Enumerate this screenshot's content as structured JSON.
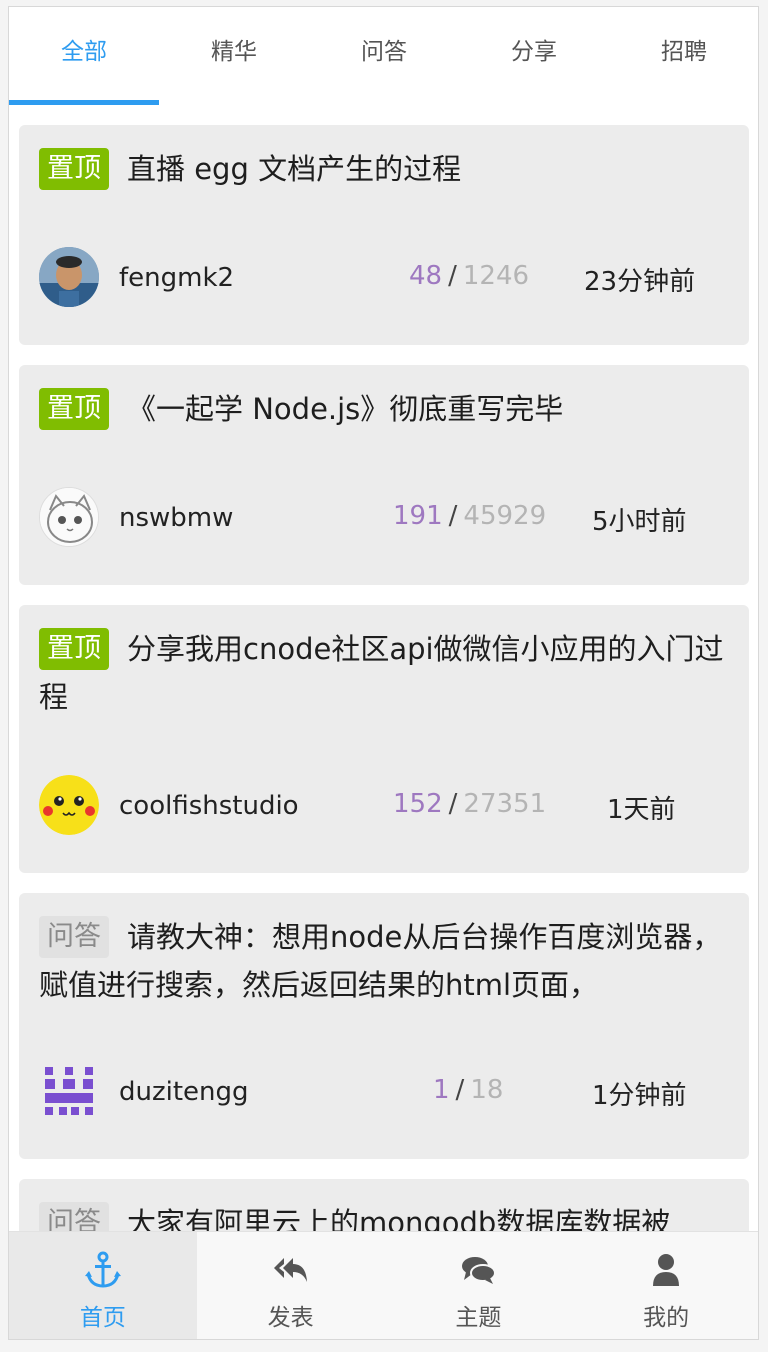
{
  "tabs": [
    {
      "label": "全部",
      "active": true
    },
    {
      "label": "精华",
      "active": false
    },
    {
      "label": "问答",
      "active": false
    },
    {
      "label": "分享",
      "active": false
    },
    {
      "label": "招聘",
      "active": false
    }
  ],
  "topics": [
    {
      "tag": "置顶",
      "title": "直播 egg 文档产生的过程",
      "author": "fengmk2",
      "replies": "48",
      "views": "1246",
      "time": "23分钟前"
    },
    {
      "tag": "置顶",
      "title": "《一起学 Node.js》彻底重写完毕",
      "author": "nswbmw",
      "replies": "191",
      "views": "45929",
      "time": "5小时前"
    },
    {
      "tag": "置顶",
      "title": "分享我用cnode社区api做微信小应用的入门过程",
      "author": "coolfishstudio",
      "replies": "152",
      "views": "27351",
      "time": "1天前"
    },
    {
      "tag": "问答",
      "title": "请教大神：想用node从后台操作百度浏览器，赋值进行搜索，然后返回结果的html页面，",
      "author": "duzitengg",
      "replies": "1",
      "views": "18",
      "time": "1分钟前"
    },
    {
      "tag": "问答",
      "title": "大家有阿里云上的mongodb数据库数据被"
    }
  ],
  "stat_separator": "/",
  "bottom_nav": [
    {
      "label": "首页",
      "icon": "anchor-icon",
      "active": true
    },
    {
      "label": "发表",
      "icon": "reply-all-icon",
      "active": false
    },
    {
      "label": "主题",
      "icon": "comments-icon",
      "active": false
    },
    {
      "label": "我的",
      "icon": "user-icon",
      "active": false
    }
  ],
  "colors": {
    "accent": "#2e9cf0",
    "top_tag": "#80bd01",
    "reply_count": "#9e78c0",
    "view_count": "#b4b4b4"
  }
}
